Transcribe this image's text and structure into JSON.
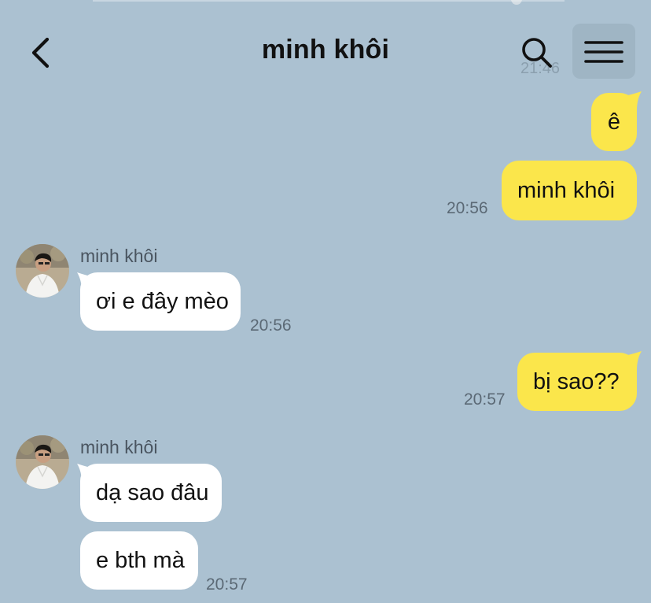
{
  "header": {
    "title": "minh khôi",
    "back_icon": "chevron-left-icon",
    "search_icon": "search-icon",
    "menu_icon": "hamburger-menu-icon",
    "faded_time": "21:46"
  },
  "colors": {
    "background": "#abc1d1",
    "my_bubble": "#fbe64b",
    "their_bubble": "#ffffff"
  },
  "messages": [
    {
      "from": "me",
      "text": "ê"
    },
    {
      "from": "me",
      "text": "minh khôi",
      "time": "20:56"
    },
    {
      "from": "them",
      "sender": "minh khôi",
      "text": "ơi e đây mèo",
      "time": "20:56"
    },
    {
      "from": "me",
      "text": "bị sao??",
      "time": "20:57"
    },
    {
      "from": "them",
      "sender": "minh khôi",
      "text": "dạ sao đâu"
    },
    {
      "from": "them",
      "text": "e bth mà",
      "time": "20:57"
    }
  ]
}
